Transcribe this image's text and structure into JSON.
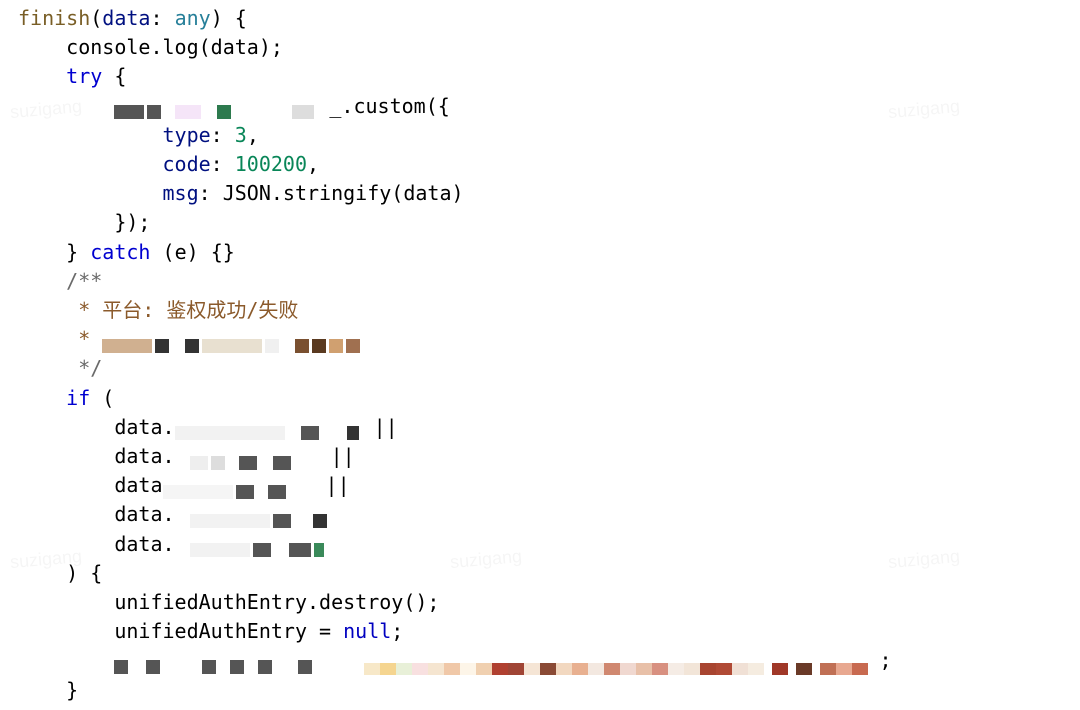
{
  "code": {
    "line1_finish": "finish",
    "line1_data": "data",
    "line1_any": "any",
    "line2_console_log": "console.log(data);",
    "line3_try": "try",
    "line3_open": " {",
    "line4_custom": ".custom({",
    "line5_type": "type",
    "line5_type_val": "3",
    "line6_code": "code",
    "line6_code_val": "100200",
    "line7_msg": "msg",
    "line7_msg_val": "JSON.stringify(data)",
    "line8_close": "});",
    "line9_catch": "} catch (e) {}",
    "line10_comment_open": "/**",
    "line11_comment": " * 平台: 鉴权成功/失败",
    "line12_comment_prefix": " * ",
    "line13_comment_close": " */",
    "line14_if": "if",
    "line14_open": " (",
    "line15_prefix": "data.",
    "line15_or": " ||",
    "line16_prefix": "data.",
    "line16_or": " ||",
    "line17_prefix": "data",
    "line17_or": " ||",
    "line18_prefix": "data.",
    "line19_prefix": "data.",
    "line20_close": ") {",
    "line21": "unifiedAuthEntry.destroy();",
    "line22_a": "unifiedAuthEntry = ",
    "line22_null": "null",
    "line22_semi": ";",
    "line23_semi": ";",
    "line24": "}"
  }
}
